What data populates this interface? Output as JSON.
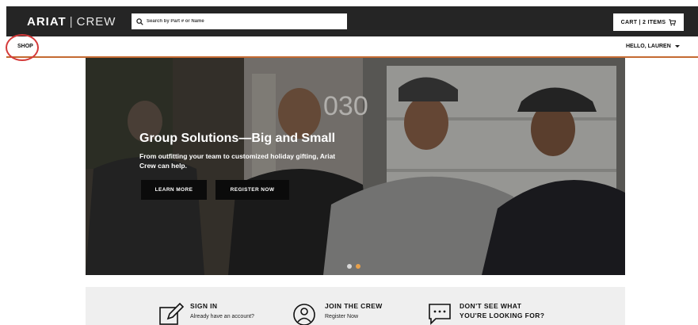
{
  "header": {
    "logo_brand": "ARIAT",
    "logo_sep": "|",
    "logo_sub": "CREW",
    "search_placeholder": "Search by Part # or Name",
    "cart_label": "CART | 2 ITEMS"
  },
  "subnav": {
    "shop_label": "SHOP",
    "greeting": "HELLO, LAUREN"
  },
  "hero": {
    "title": "Group Solutions—Big and Small",
    "subtitle": "From outfitting your team to customized holiday gifting, Ariat Crew can help.",
    "learn_more_label": "LEARN MORE",
    "register_now_label": "REGISTER NOW",
    "house_number": "030",
    "carousel_active_index": 2,
    "carousel_count": 2
  },
  "panel": {
    "cards": [
      {
        "title": "SIGN IN",
        "subtitle": "Already have an account?",
        "icon": "edit-icon"
      },
      {
        "title": "JOIN THE CREW",
        "subtitle": "Register Now",
        "icon": "user-icon"
      },
      {
        "title": "DON'T SEE WHAT",
        "title2": "YOU'RE LOOKING FOR?",
        "icon": "chat-icon"
      }
    ]
  },
  "colors": {
    "header_bg": "#252525",
    "accent_line": "#c46a32",
    "shop_highlight": "#d43a3a",
    "carousel_active": "#e8a04a"
  }
}
